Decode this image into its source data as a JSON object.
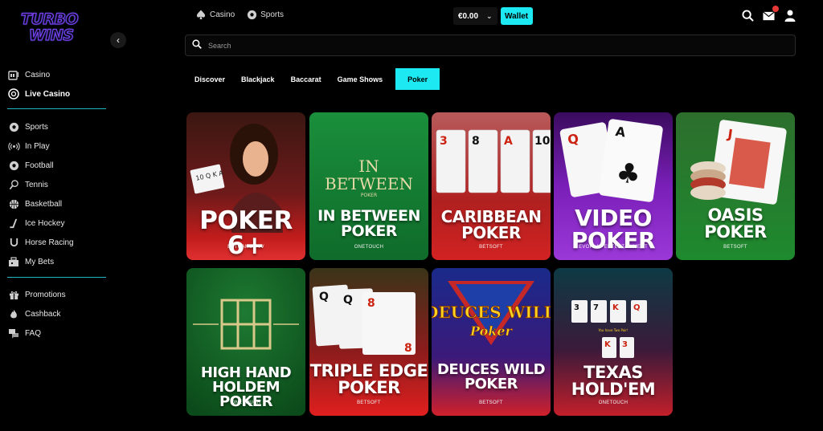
{
  "brand": {
    "logo_line1": "TURBO",
    "logo_line2": "WINS"
  },
  "sidebar": {
    "collapse_icon": "chevron-left-icon",
    "group1": [
      {
        "label": "Casino",
        "icon": "slot-machine-icon"
      },
      {
        "label": "Live Casino",
        "icon": "roulette-icon",
        "active": true
      }
    ],
    "group2": [
      {
        "label": "Sports",
        "icon": "football-icon"
      },
      {
        "label": "In Play",
        "icon": "broadcast-icon"
      },
      {
        "label": "Football",
        "icon": "soccer-ball-icon"
      },
      {
        "label": "Tennis",
        "icon": "tennis-icon"
      },
      {
        "label": "Basketball",
        "icon": "basketball-icon"
      },
      {
        "label": "Ice Hockey",
        "icon": "hockey-stick-icon"
      },
      {
        "label": "Horse Racing",
        "icon": "horseshoe-icon"
      },
      {
        "label": "My Bets",
        "icon": "bets-icon"
      }
    ],
    "group3": [
      {
        "label": "Promotions",
        "icon": "gift-icon"
      },
      {
        "label": "Cashback",
        "icon": "flame-icon"
      },
      {
        "label": "FAQ",
        "icon": "chat-icon"
      }
    ]
  },
  "header": {
    "nav": [
      {
        "label": "Casino",
        "icon": "spade-icon"
      },
      {
        "label": "Sports",
        "icon": "soccer-ball-icon"
      }
    ],
    "balance": "€0.00",
    "wallet_label": "Wallet"
  },
  "search": {
    "placeholder": "Search"
  },
  "tabs": [
    {
      "label": "Discover"
    },
    {
      "label": "Blackjack"
    },
    {
      "label": "Baccarat"
    },
    {
      "label": "Game Shows"
    },
    {
      "label": "Poker",
      "active": true
    }
  ],
  "games": [
    {
      "title": "POKER 6+",
      "provider": "BETGAMES TV"
    },
    {
      "title": "IN BETWEEN POKER",
      "logo_in": "IN",
      "logo_between": "BETWEEN",
      "logo_poker": "POKER",
      "provider": "ONETOUCH"
    },
    {
      "title": "CARIBBEAN POKER",
      "provider": "BETSOFT"
    },
    {
      "title": "VIDEO POKER",
      "provider": "EVOPLAY ENTERTAINMENT"
    },
    {
      "title": "OASIS POKER",
      "provider": "BETSOFT"
    },
    {
      "title": "HIGH HAND HOLDEM POKER",
      "provider": "ONETOUCH"
    },
    {
      "title": "TRIPLE EDGE POKER",
      "provider": "BETSOFT"
    },
    {
      "title": "DEUCES WILD POKER",
      "logo_deuces": "DEUCES WILD",
      "logo_poker": "Poker",
      "provider": "BETSOFT"
    },
    {
      "title": "TEXAS HOLD'EM",
      "tagline": "You have Two Pair!",
      "provider": "ONETOUCH"
    }
  ],
  "colors": {
    "accent": "#1de9f2",
    "divider": "#1fb6c4",
    "badge": "#e53935"
  }
}
